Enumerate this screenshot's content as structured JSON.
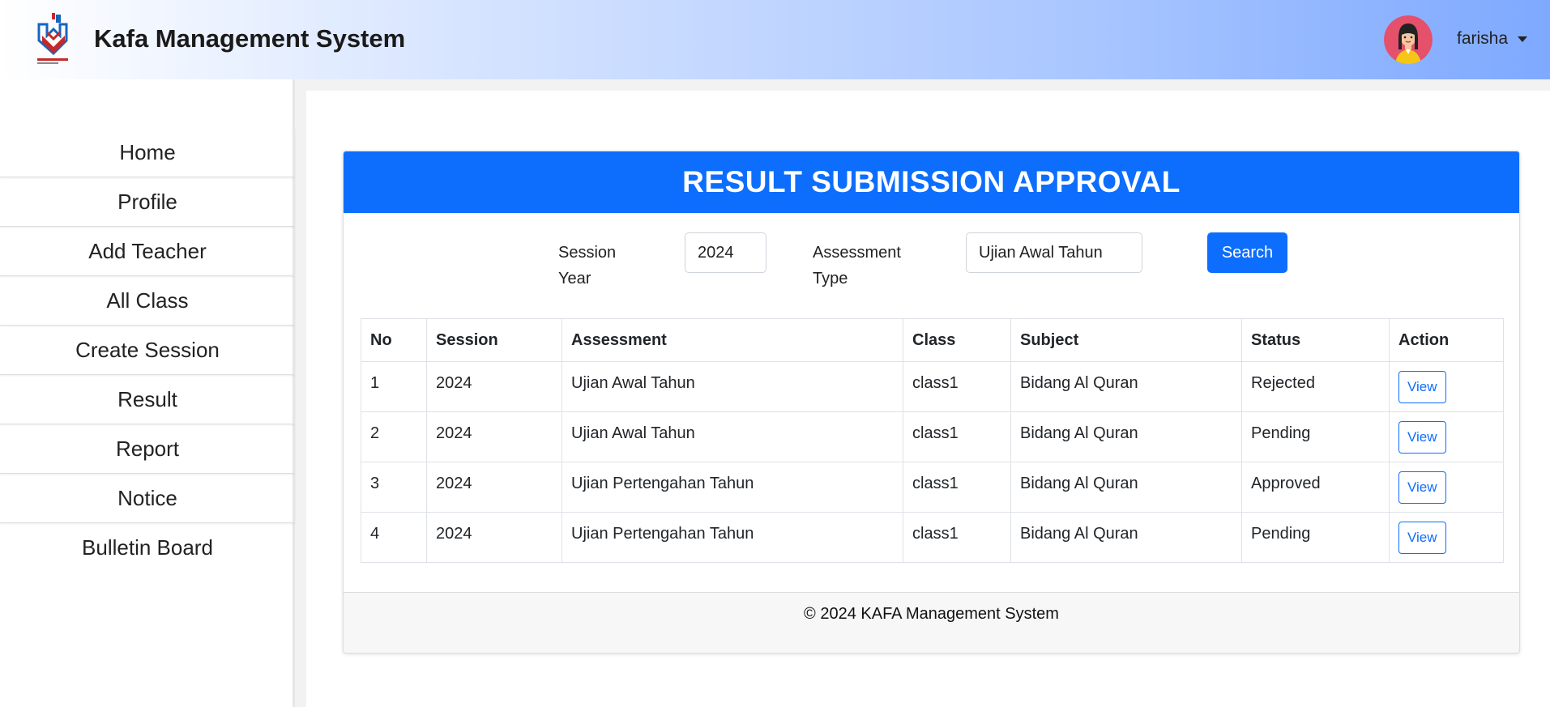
{
  "header": {
    "app_title": "Kafa Management System",
    "username": "farisha"
  },
  "sidebar": {
    "items": [
      {
        "label": "Home"
      },
      {
        "label": "Profile"
      },
      {
        "label": "Add Teacher"
      },
      {
        "label": "All Class"
      },
      {
        "label": "Create Session"
      },
      {
        "label": "Result"
      },
      {
        "label": "Report"
      },
      {
        "label": "Notice"
      },
      {
        "label": "Bulletin Board"
      }
    ]
  },
  "page": {
    "title": "RESULT SUBMISSION APPROVAL",
    "filters": {
      "session_year_label_line1": "Session",
      "session_year_label_line2": "Year",
      "session_year_value": "2024",
      "assessment_type_label_line1": "Assessment",
      "assessment_type_label_line2": "Type",
      "assessment_type_value": "Ujian Awal Tahun",
      "search_label": "Search"
    },
    "table": {
      "headers": [
        "No",
        "Session",
        "Assessment",
        "Class",
        "Subject",
        "Status",
        "Action"
      ],
      "rows": [
        {
          "no": "1",
          "session": "2024",
          "assessment": "Ujian Awal Tahun",
          "class": "class1",
          "subject": "Bidang Al Quran",
          "status": "Rejected",
          "action": "View"
        },
        {
          "no": "2",
          "session": "2024",
          "assessment": "Ujian Awal Tahun",
          "class": "class1",
          "subject": "Bidang Al Quran",
          "status": "Pending",
          "action": "View"
        },
        {
          "no": "3",
          "session": "2024",
          "assessment": "Ujian Pertengahan Tahun",
          "class": "class1",
          "subject": "Bidang Al Quran",
          "status": "Approved",
          "action": "View"
        },
        {
          "no": "4",
          "session": "2024",
          "assessment": "Ujian Pertengahan Tahun",
          "class": "class1",
          "subject": "Bidang Al Quran",
          "status": "Pending",
          "action": "View"
        }
      ]
    },
    "footer": "© 2024 KAFA Management System"
  },
  "colors": {
    "primary": "#0d6efd",
    "header_gradient_end": "#7ea9ff"
  }
}
